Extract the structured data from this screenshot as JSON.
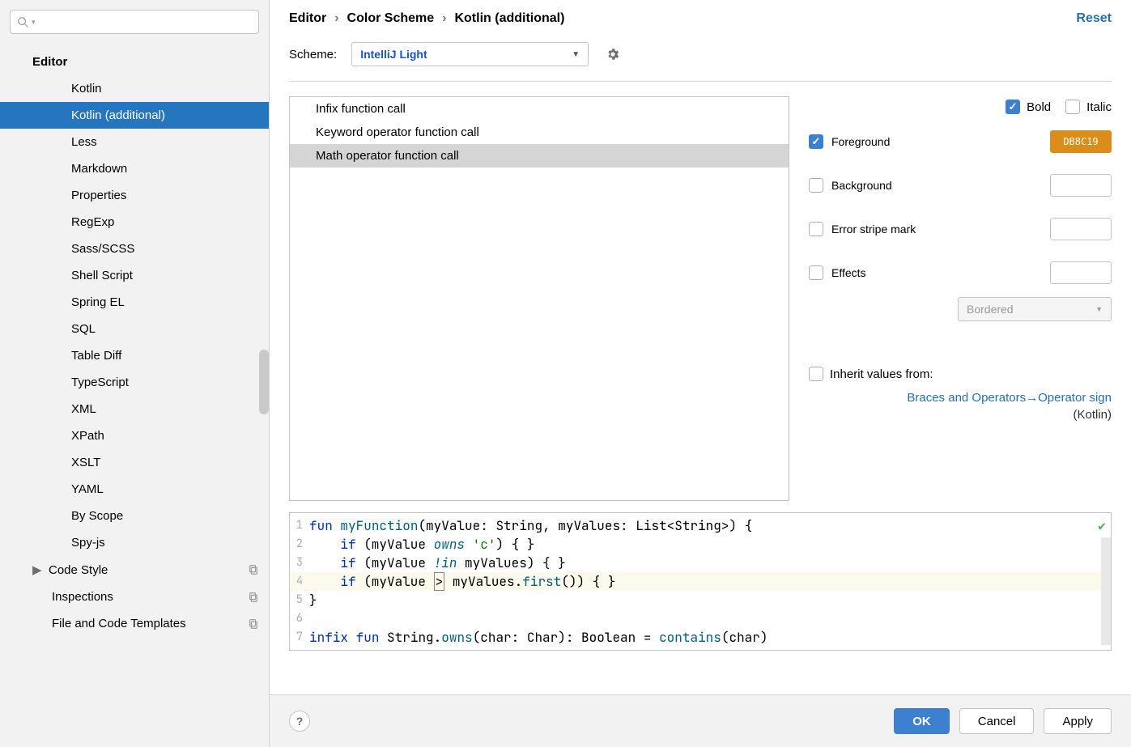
{
  "sidebar": {
    "search_placeholder": "",
    "header": "Editor",
    "items": [
      {
        "label": "Kotlin",
        "level": 2,
        "selected": false
      },
      {
        "label": "Kotlin (additional)",
        "level": 2,
        "selected": true
      },
      {
        "label": "Less",
        "level": 2,
        "selected": false
      },
      {
        "label": "Markdown",
        "level": 2,
        "selected": false
      },
      {
        "label": "Properties",
        "level": 2,
        "selected": false
      },
      {
        "label": "RegExp",
        "level": 2,
        "selected": false
      },
      {
        "label": "Sass/SCSS",
        "level": 2,
        "selected": false
      },
      {
        "label": "Shell Script",
        "level": 2,
        "selected": false
      },
      {
        "label": "Spring EL",
        "level": 2,
        "selected": false
      },
      {
        "label": "SQL",
        "level": 2,
        "selected": false
      },
      {
        "label": "Table Diff",
        "level": 2,
        "selected": false
      },
      {
        "label": "TypeScript",
        "level": 2,
        "selected": false
      },
      {
        "label": "XML",
        "level": 2,
        "selected": false
      },
      {
        "label": "XPath",
        "level": 2,
        "selected": false
      },
      {
        "label": "XSLT",
        "level": 2,
        "selected": false
      },
      {
        "label": "YAML",
        "level": 2,
        "selected": false
      },
      {
        "label": "By Scope",
        "level": 2,
        "selected": false
      },
      {
        "label": "Spy-js",
        "level": 2,
        "selected": false
      },
      {
        "label": "Code Style",
        "level": 1,
        "expandable": true,
        "copy": true
      },
      {
        "label": "Inspections",
        "level": 1,
        "copy": true
      },
      {
        "label": "File and Code Templates",
        "level": 1,
        "copy": true
      }
    ]
  },
  "breadcrumb": {
    "a": "Editor",
    "b": "Color Scheme",
    "c": "Kotlin (additional)"
  },
  "reset": "Reset",
  "scheme": {
    "label": "Scheme:",
    "value": "IntelliJ Light"
  },
  "elements": [
    {
      "label": "Infix function call",
      "selected": false
    },
    {
      "label": "Keyword operator function call",
      "selected": false
    },
    {
      "label": "Math operator function call",
      "selected": true
    }
  ],
  "attrs": {
    "bold_label": "Bold",
    "bold": true,
    "italic_label": "Italic",
    "italic": false,
    "fg_label": "Foreground",
    "fg_on": true,
    "fg_color": "DB8C19",
    "bg_label": "Background",
    "bg_on": false,
    "stripe_label": "Error stripe mark",
    "stripe_on": false,
    "effects_label": "Effects",
    "effects_on": false,
    "effects_type": "Bordered",
    "inherit_label": "Inherit values from:",
    "inherit_link": "Braces and Operators→Operator sign",
    "inherit_sub": "(Kotlin)"
  },
  "preview": {
    "lines": [
      {
        "n": "1"
      },
      {
        "n": "2"
      },
      {
        "n": "3"
      },
      {
        "n": "4"
      },
      {
        "n": "5"
      },
      {
        "n": "6"
      },
      {
        "n": "7"
      }
    ]
  },
  "footer": {
    "ok": "OK",
    "cancel": "Cancel",
    "apply": "Apply",
    "help": "?"
  }
}
